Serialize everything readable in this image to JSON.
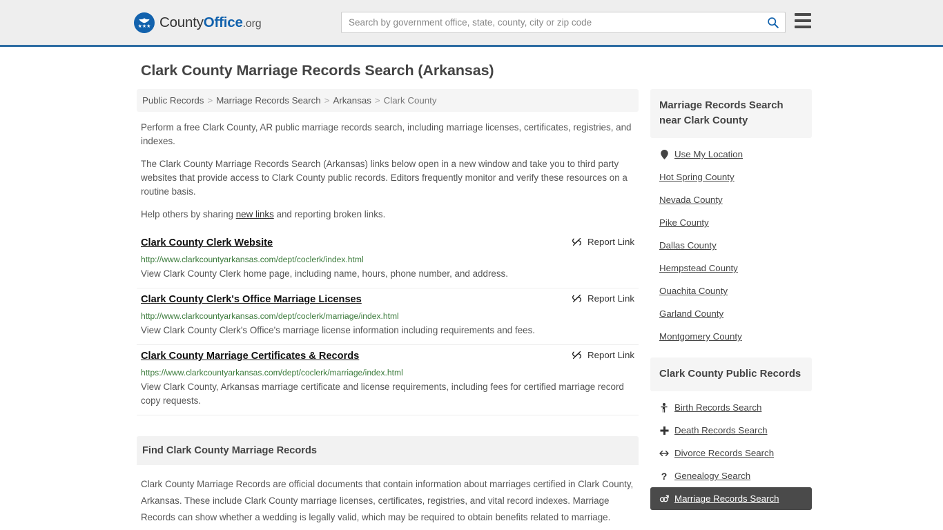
{
  "header": {
    "brand": {
      "part1": "County",
      "part2": "Office",
      "part3": ".org",
      "icon": "eagle-seal-logo"
    },
    "search": {
      "placeholder": "Search by government office, state, county, city or zip code",
      "value": "",
      "button_icon": "search-icon"
    },
    "menu_icon": "hamburger-menu-icon",
    "accent_color": "#2d6ca2"
  },
  "page": {
    "title": "Clark County Marriage Records Search (Arkansas)"
  },
  "breadcrumb": {
    "items": [
      "Public Records",
      "Marriage Records Search",
      "Arkansas",
      "Clark County"
    ],
    "separator": ">"
  },
  "intro": {
    "p1": "Perform a free Clark County, AR public marriage records search, including marriage licenses, certificates, registries, and indexes.",
    "p2": "The Clark County Marriage Records Search (Arkansas) links below open in a new window and take you to third party websites that provide access to Clark County public records. Editors frequently monitor and verify these resources on a routine basis.",
    "p3_before": "Help others by sharing ",
    "p3_link": "new links",
    "p3_after": " and reporting broken links."
  },
  "results": {
    "report_label": "Report Link",
    "report_icon": "broken-link-icon",
    "items": [
      {
        "title": "Clark County Clerk Website",
        "url": "http://www.clarkcountyarkansas.com/dept/coclerk/index.html",
        "description": "View Clark County Clerk home page, including name, hours, phone number, and address."
      },
      {
        "title": "Clark County Clerk's Office Marriage Licenses",
        "url": "http://www.clarkcountyarkansas.com/dept/coclerk/marriage/index.html",
        "description": "View Clark County Clerk's Office's marriage license information including requirements and fees."
      },
      {
        "title": "Clark County Marriage Certificates & Records",
        "url": "https://www.clarkcountyarkansas.com/dept/coclerk/marriage/index.html",
        "description": "View Clark County, Arkansas marriage certificate and license requirements, including fees for certified marriage record copy requests."
      }
    ]
  },
  "find_panel": {
    "heading": "Find Clark County Marriage Records",
    "body": "Clark County Marriage Records are official documents that contain information about marriages certified in Clark County, Arkansas. These include Clark County marriage licenses, certificates, registries, and vital record indexes. Marriage Records can show whether a wedding is legally valid, which may be required to obtain benefits related to marriage."
  },
  "sidebar": {
    "near_box": {
      "heading": "Marriage Records Search near Clark County",
      "items": [
        {
          "label": "Use My Location",
          "icon": "map-pin-icon"
        },
        {
          "label": "Hot Spring County",
          "icon": ""
        },
        {
          "label": "Nevada County",
          "icon": ""
        },
        {
          "label": "Pike County",
          "icon": ""
        },
        {
          "label": "Dallas County",
          "icon": ""
        },
        {
          "label": "Hempstead County",
          "icon": ""
        },
        {
          "label": "Ouachita County",
          "icon": ""
        },
        {
          "label": "Garland County",
          "icon": ""
        },
        {
          "label": "Montgomery County",
          "icon": ""
        }
      ]
    },
    "public_records_box": {
      "heading": "Clark County Public Records",
      "items": [
        {
          "label": "Birth Records Search",
          "icon": "baby-icon",
          "glyph": "♁",
          "active": false
        },
        {
          "label": "Death Records Search",
          "icon": "cross-icon",
          "glyph": "✚",
          "active": false
        },
        {
          "label": "Divorce Records Search",
          "icon": "double-arrow-icon",
          "glyph": "↔",
          "active": false
        },
        {
          "label": "Genealogy Search",
          "icon": "question-mark-icon",
          "glyph": "?",
          "active": false
        },
        {
          "label": "Marriage Records Search",
          "icon": "marriage-symbol-icon",
          "glyph": "⚥",
          "active": true
        }
      ]
    }
  }
}
